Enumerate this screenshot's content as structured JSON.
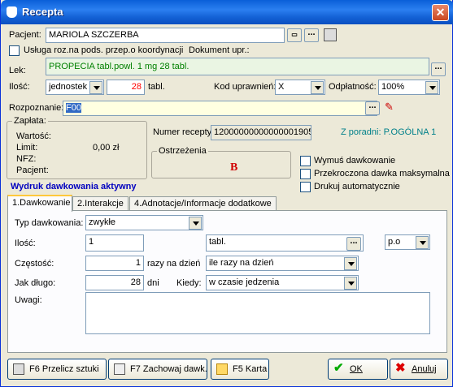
{
  "window": {
    "title": "Recepta"
  },
  "patient": {
    "label": "Pacjent:",
    "value": "MARIOLA SZCZERBA",
    "more": "..."
  },
  "service": {
    "label": "Usługa roz.na pods. przep.o koordynacji",
    "doc_label": "Dokument upr.:"
  },
  "drug": {
    "label": "Lek:",
    "value": "PROPECIA tabl.powl. 1 mg 28 tabl.",
    "more": "..."
  },
  "quantity": {
    "label": "Ilość:",
    "unit": "jednostek",
    "value": "28",
    "suffix": "tabl."
  },
  "entitlement": {
    "label": "Kod uprawnień:",
    "value": "X"
  },
  "payment": {
    "label": "Odpłatność:",
    "value": "100%"
  },
  "diagnosis": {
    "label": "Rozpoznanie:",
    "value": "F00",
    "more": "..."
  },
  "payments_box": {
    "title": "Zapłata:",
    "value_label": "Wartość:",
    "limit_label": "Limit:",
    "limit_value": "0,00 zł",
    "nfz_label": "NFZ:",
    "patient_label": "Pacjent:"
  },
  "prescription": {
    "label": "Numer recepty:",
    "value": "12000000000000001905"
  },
  "clinic": {
    "value": "Z poradni: P.OGÓLNA 1"
  },
  "warnings": {
    "title": "Ostrzeżenia",
    "value": "B"
  },
  "print_status": "Wydruk dawkowania aktywny",
  "options": [
    {
      "label": "Wymuś dawkowanie"
    },
    {
      "label": "Przekroczona dawka maksymalna"
    },
    {
      "label": "Drukuj automatycznie"
    }
  ],
  "tabs": [
    {
      "label": "1.Dawkowanie"
    },
    {
      "label": "2.Interakcje"
    },
    {
      "label": "4.Adnotacje/Informacje dodatkowe"
    }
  ],
  "dosage": {
    "type_label": "Typ dawkowania:",
    "type_value": "zwykłe",
    "qty_label": "Ilość:",
    "qty_value": "1",
    "form_value": "tabl.",
    "form_more": "...",
    "route_value": "p.o",
    "freq_label": "Częstość:",
    "freq_value": "1",
    "freq_suffix": "razy na dzień",
    "freq_mode": "ile razy na dzień",
    "dur_label": "Jak długo:",
    "dur_value": "28",
    "dur_suffix": "dni",
    "when_label": "Kiedy:",
    "when_value": "w czasie jedzenia",
    "notes_label": "Uwagi:"
  },
  "buttons": {
    "recalc": "F6 Przelicz sztuki",
    "save_dose": "F7 Zachowaj dawk.",
    "card": "F5 Karta",
    "ok": "OK",
    "cancel": "Anuluj"
  }
}
